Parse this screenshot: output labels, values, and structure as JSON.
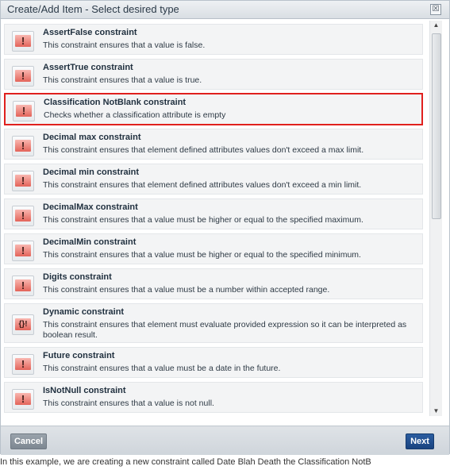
{
  "dialog": {
    "title": "Create/Add Item - Select desired type",
    "close_glyph": "☒"
  },
  "items": [
    {
      "name": "AssertFalse constraint",
      "desc": "This constraint ensures that a value is false.",
      "icon": "!"
    },
    {
      "name": "AssertTrue constraint",
      "desc": "This constraint ensures that a value is true.",
      "icon": "!"
    },
    {
      "name": "Classification NotBlank constraint",
      "desc": "Checks whether a classification attribute is empty",
      "icon": "!"
    },
    {
      "name": "Decimal max constraint",
      "desc": "This constraint ensures that element defined attributes values don't exceed a max limit.",
      "icon": "!"
    },
    {
      "name": "Decimal min constraint",
      "desc": "This constraint ensures that element defined attributes values don't exceed a min limit.",
      "icon": "!"
    },
    {
      "name": "DecimalMax constraint",
      "desc": "This constraint ensures that a value must be higher or equal to the specified maximum.",
      "icon": "!"
    },
    {
      "name": "DecimalMin constraint",
      "desc": "This constraint ensures that a value must be higher or equal to the specified minimum.",
      "icon": "!"
    },
    {
      "name": "Digits constraint",
      "desc": "This constraint ensures that a value must be a number within accepted range.",
      "icon": "!"
    },
    {
      "name": "Dynamic constraint",
      "desc": "This constraint ensures that element must evaluate provided expression so it can be interpreted as boolean result.",
      "icon": "{}!"
    },
    {
      "name": "Future constraint",
      "desc": "This constraint ensures that a value must be a date in the future.",
      "icon": "!"
    },
    {
      "name": "IsNotNull constraint",
      "desc": "This constraint ensures that a value is not null.",
      "icon": "!"
    }
  ],
  "selected_index": 2,
  "footer": {
    "cancel_label": "Cancel",
    "next_label": "Next"
  },
  "caption": "In this example, we are creating a new constraint called Date Blah Death the Classification NotB"
}
